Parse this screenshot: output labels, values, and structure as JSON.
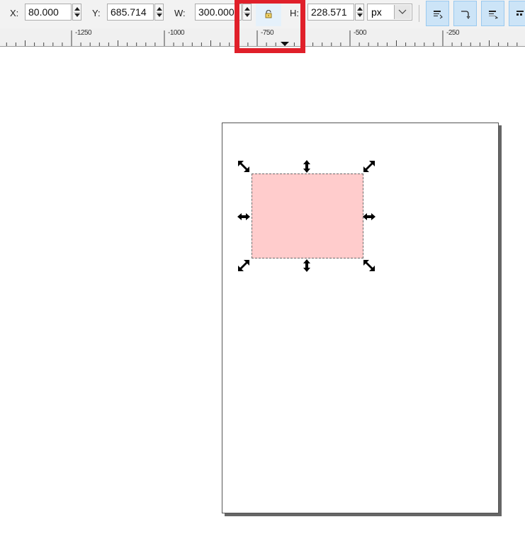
{
  "toolbar": {
    "x_label": "X:",
    "x_value": "80.000",
    "y_label": "Y:",
    "y_value": "685.714",
    "w_label": "W:",
    "w_value": "300.000",
    "lock_icon": "lock-icon",
    "h_label": "H:",
    "h_value": "228.571",
    "unit_value": "px",
    "buttons": [
      "scale-stroke-icon",
      "scale-corners-icon",
      "move-gradients-icon",
      "move-patterns-icon"
    ]
  },
  "ruler": {
    "labels": [
      "-1250",
      "-1000",
      "-750",
      "-500",
      "-250"
    ]
  },
  "colors": {
    "selection_fill": "#ffcccc",
    "highlight": "#e0202a",
    "active_button": "#cce4f7"
  }
}
